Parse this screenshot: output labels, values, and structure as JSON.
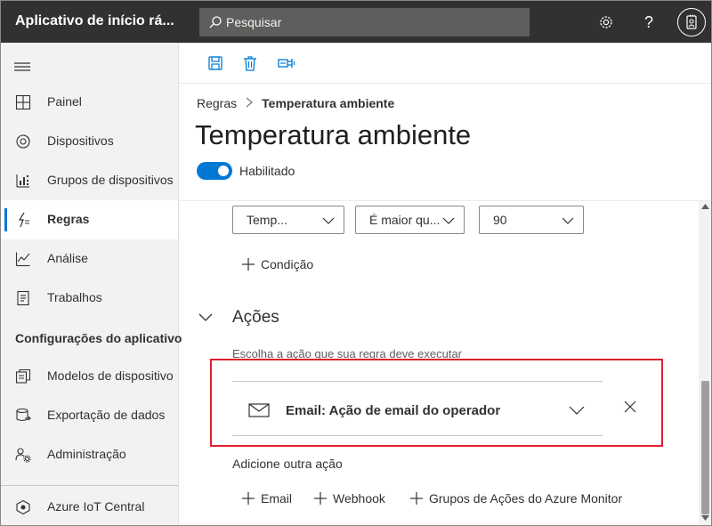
{
  "topbar": {
    "app_title": "Aplicativo de início rá...",
    "search_placeholder": "Pesquisar",
    "icons": [
      "gear-icon",
      "help-icon",
      "avatar-icon"
    ],
    "colors": {
      "background": "#323130",
      "search": "#605e5c"
    }
  },
  "sidebar": {
    "items": [
      {
        "label": "Painel",
        "icon": "dashboard-icon"
      },
      {
        "label": "Dispositivos",
        "icon": "devices-icon"
      },
      {
        "label": "Grupos de dispositivos",
        "icon": "device-groups-icon"
      },
      {
        "label": "Regras",
        "icon": "rules-icon",
        "active": true
      },
      {
        "label": "Análise",
        "icon": "analytics-icon"
      },
      {
        "label": "Trabalhos",
        "icon": "jobs-icon"
      }
    ],
    "section_title": "Configurações do aplicativo",
    "settings_items": [
      {
        "label": "Modelos de dispositivo",
        "icon": "device-templates-icon"
      },
      {
        "label": "Exportação de dados",
        "icon": "data-export-icon"
      },
      {
        "label": "Administração",
        "icon": "administration-icon"
      }
    ],
    "footer_item": {
      "label": "Azure IoT Central",
      "icon": "azure-iot-central-icon"
    }
  },
  "command_bar": {
    "buttons": [
      "save-icon",
      "delete-icon",
      "test-action-icon"
    ]
  },
  "header": {
    "breadcrumb_parent": "Regras",
    "breadcrumb_current": "Temperatura ambiente",
    "title": "Temperatura ambiente",
    "toggle_label": "Habilitado",
    "toggle_on": true
  },
  "conditions": {
    "telemetry_value": "Temp...",
    "operator_value": "É maior qu...",
    "threshold_value": "90",
    "add_condition_label": "Condição"
  },
  "actions": {
    "section_title": "Ações",
    "hint": "Escolha a ação que sua regra deve executar",
    "card_title": "Email: Ação de email do operador",
    "add_another_label": "Adicione outra ação",
    "add_buttons": [
      "Email",
      "Webhook",
      "Grupos de Ações do Azure Monitor"
    ],
    "highlight_color": "#e0202e"
  },
  "accent_color": "#0078d4"
}
